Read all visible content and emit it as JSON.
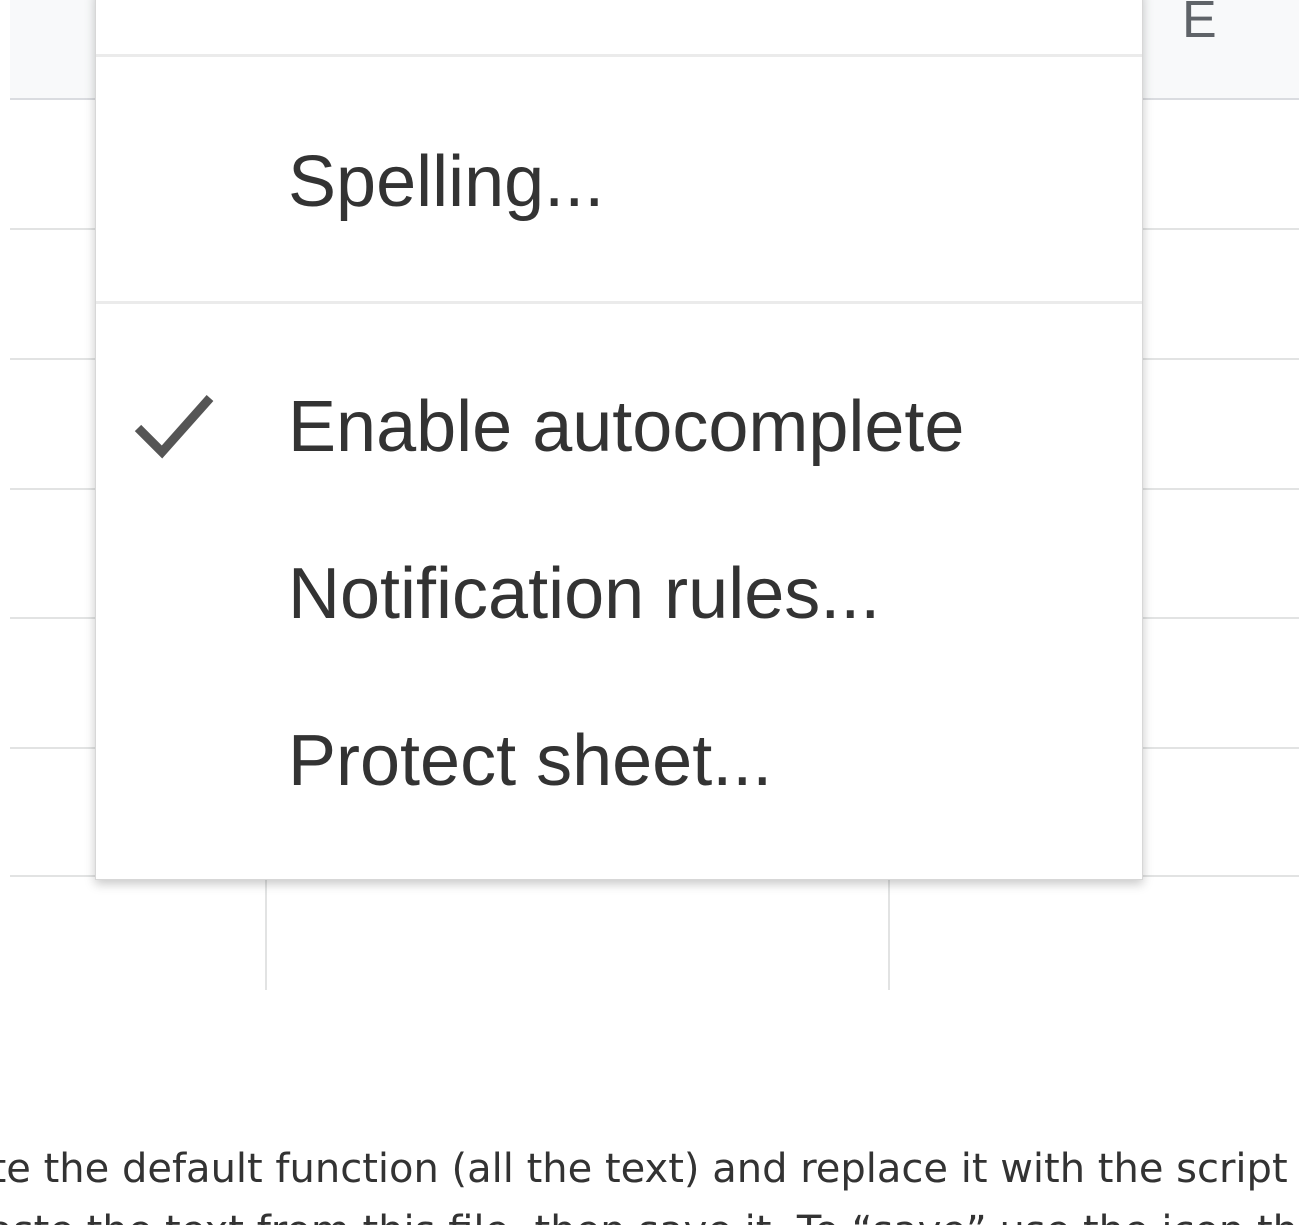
{
  "sheet": {
    "column_letter": "E"
  },
  "menu": {
    "items": [
      {
        "label": "Spelling...",
        "checked": false
      },
      {
        "label": "Enable autocomplete",
        "checked": true
      },
      {
        "label": "Notification rules...",
        "checked": false
      },
      {
        "label": "Protect sheet...",
        "checked": false
      }
    ],
    "check_icon": "checkmark-icon"
  },
  "document": {
    "line1": "ete the default function (all the text) and replace it with the script linke",
    "line2": "  Paste the text from this file, then save it. To “save” use the icon that"
  },
  "colors": {
    "menu_text": "#333333",
    "grid_line": "#e2e3e3",
    "header_bg": "#f8f9fa"
  }
}
